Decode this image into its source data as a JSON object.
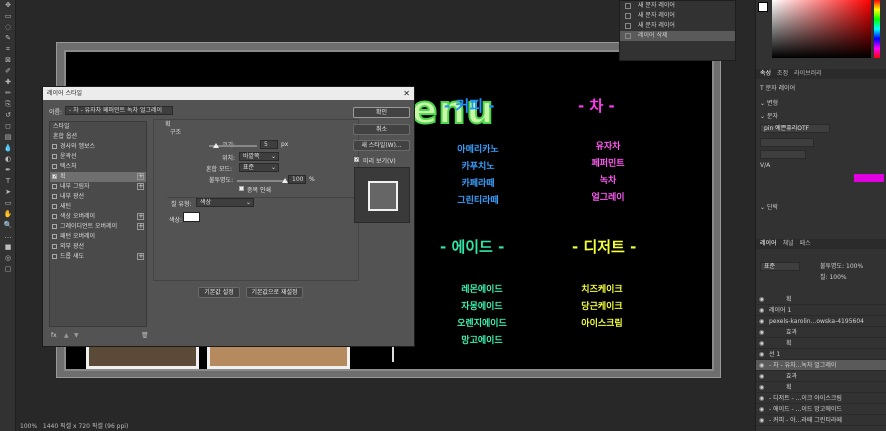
{
  "toolbar": {
    "icons": [
      "move-icon",
      "marquee-icon",
      "lasso-icon",
      "quick-select-icon",
      "crop-icon",
      "frame-icon",
      "eyedropper-icon",
      "spot-heal-icon",
      "brush-icon",
      "stamp-icon",
      "history-brush-icon",
      "eraser-icon",
      "gradient-icon",
      "blur-icon",
      "dodge-icon",
      "pen-icon",
      "type-icon",
      "path-select-icon",
      "rectangle-icon",
      "hand-icon",
      "zoom-icon",
      "more-icon",
      "foreground-color-icon",
      "quick-mask-icon",
      "screen-mode-icon"
    ]
  },
  "artboard": {
    "title": "menu",
    "sections": [
      {
        "title": "- 커피 -",
        "color": "#1e90ff",
        "items": [
          "아메리카노",
          "카푸치노",
          "카페라떼",
          "그린티라떼"
        ],
        "item_color": "#3aa0ff"
      },
      {
        "title": "- 차 -",
        "color": "#ff3cf0",
        "items": [
          "유자차",
          "페퍼민트",
          "녹차",
          "얼그레이"
        ],
        "item_color": "#ff5af2"
      },
      {
        "title": "- 에이드 -",
        "color": "#2fe6a8",
        "items": [
          "레몬에이드",
          "자몽에이드",
          "오렌지에이드",
          "망고에이드"
        ],
        "item_color": "#3ef0b0"
      },
      {
        "title": "- 디저트 -",
        "color": "#f4ff3a",
        "items": [
          "치즈케이크",
          "당근케이크",
          "아이스크림"
        ],
        "item_color": "#f4ff3a"
      }
    ]
  },
  "dialog": {
    "title": "레이어 스타일",
    "name_label": "이름:",
    "name_value": "- 차 - 유자차 페퍼민트 녹차 얼그레이",
    "styles_header": "스타일",
    "blend_options": "혼합 옵션",
    "style_items": [
      {
        "label": "경사와 엠보스",
        "checked": false,
        "plus": false
      },
      {
        "label": "윤곽선",
        "checked": false,
        "plus": false
      },
      {
        "label": "텍스처",
        "checked": false,
        "plus": false
      },
      {
        "label": "획",
        "checked": true,
        "plus": true,
        "active": true
      },
      {
        "label": "내부 그림자",
        "checked": false,
        "plus": true
      },
      {
        "label": "내부 광선",
        "checked": false,
        "plus": false
      },
      {
        "label": "새틴",
        "checked": false,
        "plus": false
      },
      {
        "label": "색상 오버레이",
        "checked": false,
        "plus": true
      },
      {
        "label": "그레이디언트 오버레이",
        "checked": false,
        "plus": true
      },
      {
        "label": "패턴 오버레이",
        "checked": false,
        "plus": false
      },
      {
        "label": "외부 광선",
        "checked": false,
        "plus": false
      },
      {
        "label": "드롭 섀도",
        "checked": false,
        "plus": true
      }
    ],
    "panel_title": "획",
    "structure": "구조",
    "size_label": "크기:",
    "size_value": "5",
    "size_unit": "px",
    "position_label": "위치:",
    "position_value": "바깥쪽",
    "blend_label": "혼합 모드:",
    "blend_value": "표준",
    "opacity_label": "불투명도:",
    "opacity_value": "100",
    "opacity_unit": "%",
    "overprint": "중복 인쇄",
    "fill_type_label": "칠 유형:",
    "fill_type_value": "색상",
    "color_label": "색상:",
    "btn_default": "기본값 설정",
    "btn_reset": "기본값으로 재설정",
    "ok": "확인",
    "cancel": "취소",
    "new_style": "새 스타일(W)...",
    "preview": "미리 보기(V)",
    "preview_checked": true,
    "size_level": 0.15,
    "opacity_level": 1.0
  },
  "history": {
    "rows": [
      "새 문자 레이어",
      "새 문자 레이어",
      "새 문자 레이어",
      "레이어 삭제"
    ]
  },
  "right_panel": {
    "tabs1": [
      "속성",
      "조정",
      "라이브러리"
    ],
    "layer_type": "문자 레이어",
    "transform": "변형",
    "character": "문자",
    "font": "pin 예쁜퓨리OTF",
    "va": "V/A",
    "paragraph": "단락",
    "tabs2": [
      "레이어",
      "채널",
      "패스"
    ],
    "blend": "표준",
    "opacity_label": "불투명도: 100%",
    "fill_label": "칠: 100%",
    "layers": [
      {
        "name": "획",
        "indent": true
      },
      {
        "name": "레이어 1",
        "indent": false
      },
      {
        "name": "pexels-karolin...owska-4195604",
        "indent": false
      },
      {
        "name": "효과",
        "indent": true
      },
      {
        "name": "획",
        "indent": true
      },
      {
        "name": "선 1",
        "indent": false
      },
      {
        "name": "- 차 - 유자...녹차 얼그레이",
        "indent": false,
        "selected": true
      },
      {
        "name": "효과",
        "indent": true
      },
      {
        "name": "획",
        "indent": true
      },
      {
        "name": "- 디저트 - ...이크 아이스크림",
        "indent": false
      },
      {
        "name": "- 에이드 - ...이드 망고에이드",
        "indent": false
      },
      {
        "name": "- 커피 - 아...라떼 그린티라떼",
        "indent": false
      }
    ],
    "accent": "#e000e0"
  },
  "status": {
    "zoom": "100%",
    "doc": "1440 픽셀 x 720 픽셀 (96 ppi)"
  }
}
